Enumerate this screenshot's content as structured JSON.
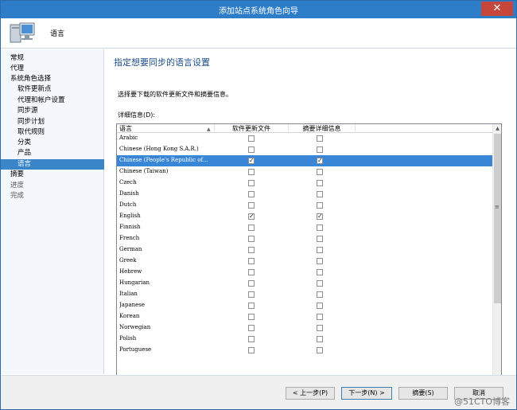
{
  "titlebar": {
    "title": "添加站点系统角色向导",
    "close": "✕"
  },
  "header": {
    "title": "语言",
    "icon": "computer-icon"
  },
  "sidebar": {
    "items": [
      {
        "label": "常规"
      },
      {
        "label": "代理"
      },
      {
        "label": "系统角色选择"
      },
      {
        "label": "软件更新点"
      },
      {
        "label": "代理和帐户设置"
      },
      {
        "label": "同步源"
      },
      {
        "label": "同步计划"
      },
      {
        "label": "取代规则"
      },
      {
        "label": "分类"
      },
      {
        "label": "产品"
      },
      {
        "label": "语言"
      },
      {
        "label": "摘要"
      },
      {
        "label": "进度"
      },
      {
        "label": "完成"
      }
    ]
  },
  "content": {
    "title": "指定想要同步的语言设置",
    "instructions": "选择要下载的软件更新文件和摘要信息。",
    "details_label": "详细信息(D):",
    "columns": [
      "语言",
      "软件更新文件",
      "摘要详细信息"
    ],
    "rows": [
      {
        "language": "Arabic",
        "files": "",
        "summary": ""
      },
      {
        "language": "Chinese (Hong Kong S.A.R.)",
        "files": "",
        "summary": ""
      },
      {
        "language": "Chinese (People's Republic of...",
        "files": "✓",
        "summary": "✓"
      },
      {
        "language": "Chinese (Taiwan)",
        "files": "",
        "summary": ""
      },
      {
        "language": "Czech",
        "files": "",
        "summary": ""
      },
      {
        "language": "Danish",
        "files": "",
        "summary": ""
      },
      {
        "language": "Dutch",
        "files": "",
        "summary": ""
      },
      {
        "language": "English",
        "files": "✓",
        "summary": "✓"
      },
      {
        "language": "Finnish",
        "files": "",
        "summary": ""
      },
      {
        "language": "French",
        "files": "",
        "summary": ""
      },
      {
        "language": "German",
        "files": "",
        "summary": ""
      },
      {
        "language": "Greek",
        "files": "",
        "summary": ""
      },
      {
        "language": "Hebrew",
        "files": "",
        "summary": ""
      },
      {
        "language": "Hungarian",
        "files": "",
        "summary": ""
      },
      {
        "language": "Italian",
        "files": "",
        "summary": ""
      },
      {
        "language": "Japanese",
        "files": "",
        "summary": ""
      },
      {
        "language": "Korean",
        "files": "",
        "summary": ""
      },
      {
        "language": "Norwegian",
        "files": "",
        "summary": ""
      },
      {
        "language": "Polish",
        "files": "",
        "summary": ""
      },
      {
        "language": "Portuguese",
        "files": "",
        "summary": ""
      }
    ]
  },
  "footer": {
    "back": "< 上一步(P)",
    "next": "下一步(N) >",
    "summary": "摘要(S)",
    "cancel": "取消",
    "watermark": "@51CTO博客"
  },
  "colors": {
    "titlebar": "#2d7dc8",
    "accent": "#3a86c8",
    "close": "#c7463c"
  }
}
